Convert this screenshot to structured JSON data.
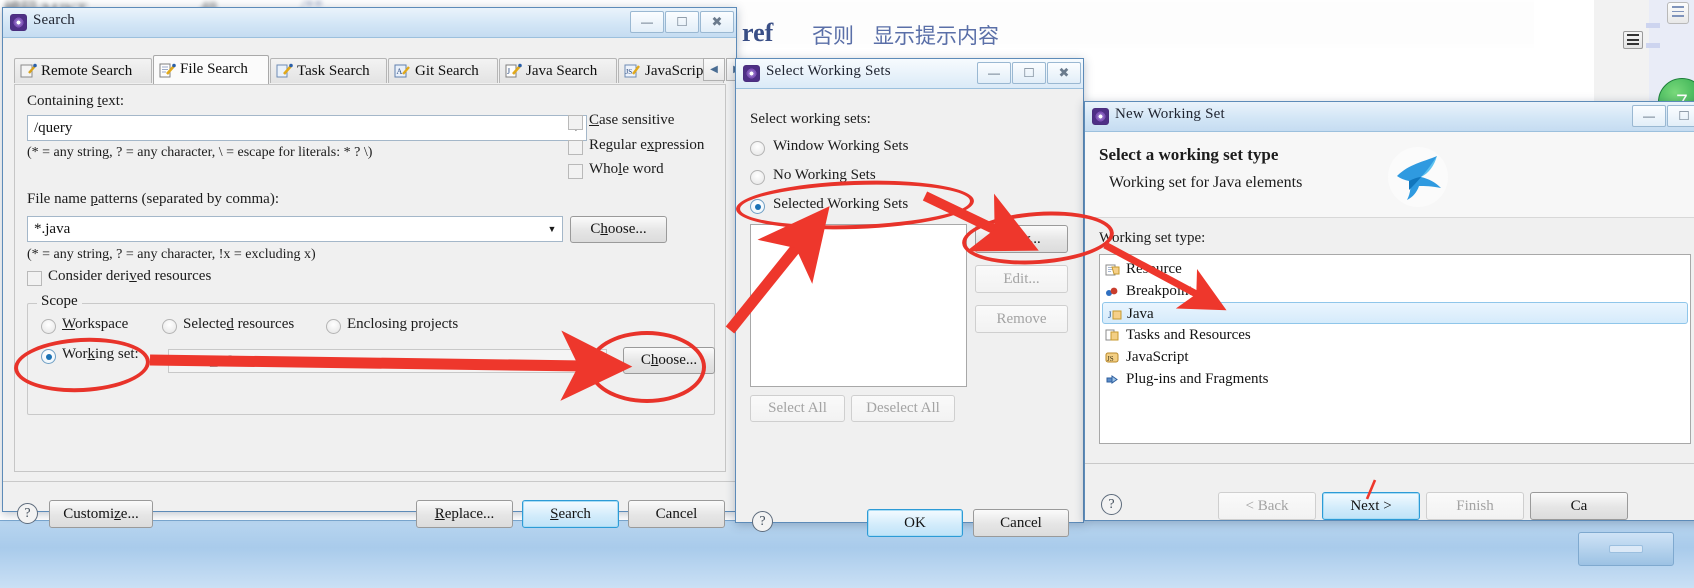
{
  "background": {
    "code_fragments": [
      "编码/MJKT",
      "48",
      "/**"
    ],
    "blurred_text": "ref",
    "chinese_text_1": "否则",
    "chinese_text_2": "显示提示内容",
    "green_badge": "7",
    "icons": [
      "view-menu-icon",
      "document-icon",
      "taskbar-button"
    ]
  },
  "search_dialog": {
    "title": "Search",
    "icon": "eclipse-search-icon",
    "window_buttons": [
      "minimize",
      "maximize",
      "close"
    ],
    "tabs": [
      {
        "label": "Remote Search",
        "icon": "remote-search-icon",
        "active": false
      },
      {
        "label": "File Search",
        "icon": "file-search-icon",
        "active": true
      },
      {
        "label": "Task Search",
        "icon": "task-search-icon",
        "active": false
      },
      {
        "label": "Git Search",
        "icon": "git-search-icon",
        "active": false
      },
      {
        "label": "Java Search",
        "icon": "java-search-icon",
        "active": false
      },
      {
        "label": "JavaScript Se",
        "icon": "javascript-search-icon",
        "active": false
      }
    ],
    "tab_nav": {
      "prev": "◀",
      "next": "▶"
    },
    "containing_text_label": "Containing text:",
    "containing_text_value": "/query",
    "containing_text_hint": "(* = any string, ? = any character, \\ = escape for literals: * ? \\)",
    "options": [
      {
        "label": "Case sensitive",
        "checked": false
      },
      {
        "label": "Regular expression",
        "checked": false
      },
      {
        "label": "Whole word",
        "checked": false
      }
    ],
    "file_patterns_label": "File name patterns (separated by comma):",
    "file_patterns_value": "*.java",
    "file_patterns_hint": "(* = any string, ? = any character, !x = excluding x)",
    "choose_patterns_button": "Choose...",
    "consider_derived": {
      "label": "Consider derived resources",
      "checked": false
    },
    "scope": {
      "group_label": "Scope",
      "radios": [
        {
          "label": "Workspace",
          "selected": false
        },
        {
          "label": "Selected resources",
          "selected": false
        },
        {
          "label": "Enclosing projects",
          "selected": false
        },
        {
          "label": "Working set:",
          "selected": true
        }
      ],
      "working_set_value": "TJKT_W",
      "choose_button": "Choose..."
    },
    "footer": {
      "help": "?",
      "customize_button": "Customize...",
      "replace_button": "Replace...",
      "search_button": "Search",
      "cancel_button": "Cancel"
    }
  },
  "select_working_sets_dialog": {
    "title": "Select Working Sets",
    "icon": "eclipse-working-set-icon",
    "window_buttons": [
      "minimize",
      "maximize",
      "close"
    ],
    "prompt": "Select working sets:",
    "radios": [
      {
        "label": "Window Working Sets",
        "selected": false
      },
      {
        "label": "No Working Sets",
        "selected": false
      },
      {
        "label": "Selected Working Sets",
        "selected": true
      }
    ],
    "list_items": [],
    "side_buttons": [
      {
        "label": "New...",
        "enabled": true
      },
      {
        "label": "Edit...",
        "enabled": false
      },
      {
        "label": "Remove",
        "enabled": false
      }
    ],
    "select_all_button": {
      "label": "Select All",
      "enabled": false
    },
    "deselect_all_button": {
      "label": "Deselect All",
      "enabled": false
    },
    "footer": {
      "help": "?",
      "ok_button": "OK",
      "cancel_button": "Cancel"
    }
  },
  "new_working_set_dialog": {
    "title": "New Working Set",
    "icon": "eclipse-working-set-icon",
    "window_buttons": [
      "minimize",
      "maximize"
    ],
    "heading": "Select a working set type",
    "subheading": "Working set for Java elements",
    "watermark": "blue-bird-icon",
    "list_label": "Working set type:",
    "types": [
      {
        "label": "Resource",
        "icon": "resource-folder-icon",
        "selected": false
      },
      {
        "label": "Breakpoint",
        "icon": "breakpoint-icon",
        "selected": false
      },
      {
        "label": "Java",
        "icon": "java-folder-icon",
        "selected": true
      },
      {
        "label": "Tasks and Resources",
        "icon": "tasks-resources-icon",
        "selected": false
      },
      {
        "label": "JavaScript",
        "icon": "javascript-icon",
        "selected": false
      },
      {
        "label": "Plug-ins and Fragments",
        "icon": "plugin-icon",
        "selected": false
      }
    ],
    "footer": {
      "help": "?",
      "back_button": {
        "label": "< Back",
        "enabled": false
      },
      "next_button": {
        "label": "Next >",
        "enabled": true,
        "default": true
      },
      "finish_button": {
        "label": "Finish",
        "enabled": false
      },
      "cancel_button": {
        "label": "Ca",
        "enabled": true
      }
    }
  },
  "annotations": {
    "accent_color": "#e8332a",
    "ellipses": [
      "working-set-radio",
      "choose-button",
      "selected-working-sets-radio",
      "new-button"
    ],
    "arrows": [
      "working-set-to-choose",
      "selected-sets-to-new",
      "arrow-to-list",
      "new-to-java-type",
      "arrow-to-next"
    ]
  }
}
